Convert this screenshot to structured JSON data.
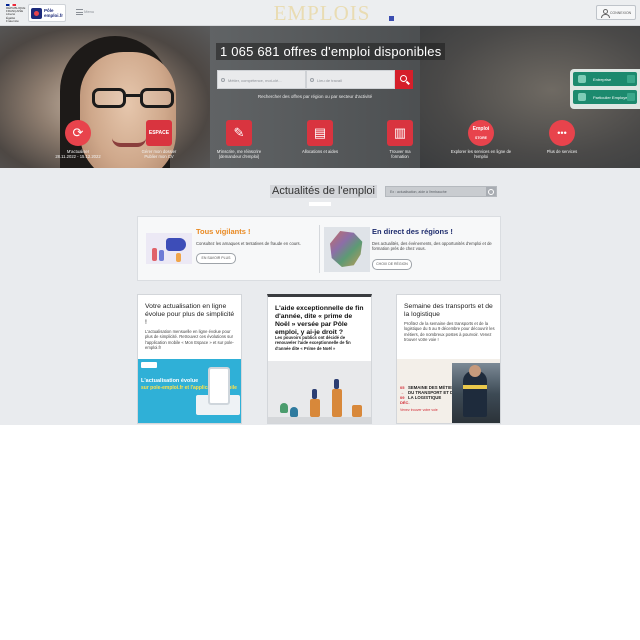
{
  "header": {
    "rf_logo_lines": [
      "RÉPUBLIQUE",
      "FRANÇAISE",
      "Liberté",
      "Égalité",
      "Fraternité"
    ],
    "pe_logo_text": [
      "Pôle",
      "emploi.fr"
    ],
    "menu_label": "Menu",
    "site_title": "EMPLOIS",
    "connexion_label": "CONNEXION"
  },
  "hero": {
    "headline": "1 065 681 offres d'emploi disponibles",
    "search_keyword_placeholder": "Métier, compétence, mot-clé...",
    "search_location_placeholder": "Lieu de travail",
    "subtext": "Rechercher des offres par région ou par secteur d'activité",
    "side_tabs": [
      "Entreprise",
      "Particulier Employeur"
    ],
    "actions": [
      {
        "label": "M'actualiser",
        "sublabel": "28.11.2022 - 15.12.2022",
        "glyph": "⟳",
        "shape": "round"
      },
      {
        "label": "Gérer mon dossier",
        "sublabel": "Publier mon CV",
        "badge": "ESPACE",
        "shape": "sq"
      },
      {
        "label": "M'inscrire, me réinscrire",
        "sublabel": "(demandeur d'emploi)",
        "glyph": "✎",
        "shape": "sq"
      },
      {
        "label": "Allocations et aides",
        "sublabel": "",
        "glyph": "▤",
        "shape": "sq"
      },
      {
        "label": "Trouver ma",
        "sublabel": "formation",
        "glyph": "▥",
        "shape": "sq"
      },
      {
        "label": "Explorer les services en ligne de",
        "sublabel": "l'emploi",
        "badge": "Emploi",
        "badge2": "STORE",
        "shape": "round"
      },
      {
        "label": "Plus de services",
        "sublabel": "",
        "glyph": "•••",
        "shape": "round"
      }
    ]
  },
  "news": {
    "title": "Actualités de l'emploi",
    "search_placeholder": "Ex : actualisation, aide à l'embauche",
    "alerts": {
      "left_title": "Tous vigilants !",
      "left_text": "Consultez les arnaques et tentatives de fraude en cours.",
      "left_button": "EN SAVOIR PLUS",
      "right_title": "En direct des régions !",
      "right_text": "Des actualités, des événements, des opportunités d'emploi et de formation près de chez vous.",
      "right_button": "CHOIX DE RÉGION"
    },
    "cards": [
      {
        "title": "Votre actualisation en ligne évolue pour plus de simplicité !",
        "text": "L'actualisation mensuelle en ligne évolue pour plus de simplicité. Retrouvez ces évolutions sur l'application mobile « Mon Espace » et sur pole-emploi.fr",
        "img_title": "L'actualisation évolue",
        "img_sub": "sur pole-emploi.fr et l'application mobile"
      },
      {
        "title": "L'aide exceptionnelle de fin d'année, dite « prime de Noël » versée par Pôle emploi, y ai-je droit ?",
        "text": "Les pouvoirs publics ont décidé de renouveler l'aide exceptionnelle de fin d'année dite « Prime de Noël »"
      },
      {
        "title": "Semaine des transports et de la logistique",
        "text": "Profitez de la semaine des transports et de la logistique du 5 au 9 décembre pour découvrir les métiers, de nombreux postes à pourvoir. Venez trouver votre voie !",
        "img_nums": [
          "05",
          "→",
          "09",
          "DÉC."
        ],
        "img_title": "SEMAINE DES MÉTIERS DU TRANSPORT ET DE LA LOGISTIQUE",
        "img_sub": "Venez trouver votre voie"
      }
    ]
  },
  "colors": {
    "brand_red": "#e8434c",
    "brand_navy": "#1c2a7a",
    "accent_green": "#1c8a6e",
    "accent_orange": "#e98a23"
  }
}
